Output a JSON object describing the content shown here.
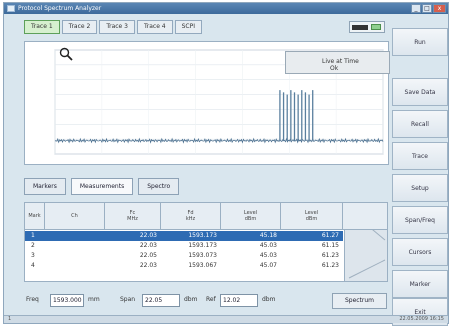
{
  "titlebar": {
    "title": "Protocol Spectrum Analyzer",
    "min": "_",
    "max": "□",
    "close": "x"
  },
  "trace_tabs": [
    "Trace 1",
    "Trace 2",
    "Trace 3",
    "Trace 4",
    "SCPI"
  ],
  "chart": {
    "ymin": -60,
    "ymax": 10,
    "xmin": 1000,
    "xmax": 1700,
    "baseline": -51,
    "burst_start": 1480,
    "burst_end": 1550
  },
  "overlay": {
    "text": "Live at Time",
    "button": "Ok"
  },
  "measure_tabs": [
    "Markers",
    "Measurements",
    "Spectro"
  ],
  "table": {
    "columns": [
      "Mark",
      "Ch",
      "Fc\nMHz",
      "Fd\nkHz",
      "Level\ndBm",
      "Level\ndBm"
    ],
    "rows": [
      [
        "1",
        "",
        "22.03",
        "1593.173",
        "45.18",
        "61.27"
      ],
      [
        "2",
        "",
        "22.03",
        "1593.173",
        "45.03",
        "61.15"
      ],
      [
        "3",
        "",
        "22.05",
        "1593.073",
        "45.03",
        "61.23"
      ],
      [
        "4",
        "",
        "22.03",
        "1593.067",
        "45.07",
        "61.23"
      ]
    ]
  },
  "bottom": {
    "freq_label": "Freq",
    "freq_value": "1593.000",
    "freq_unit": "mm",
    "span_label": "Span",
    "span_value": "22.05",
    "span_unit": "dbm",
    "ref_label": "Ref",
    "ref_value": "12.02",
    "ref_unit": "dbm",
    "button": "Spectrum"
  },
  "sidebar": [
    "Run",
    "Save Data",
    "Recall",
    "Trace",
    "Setup",
    "Span/Freq",
    "Cursors",
    "Marker",
    "Exit"
  ],
  "status": {
    "left": "1",
    "right": "22.05.2009 16:15"
  }
}
